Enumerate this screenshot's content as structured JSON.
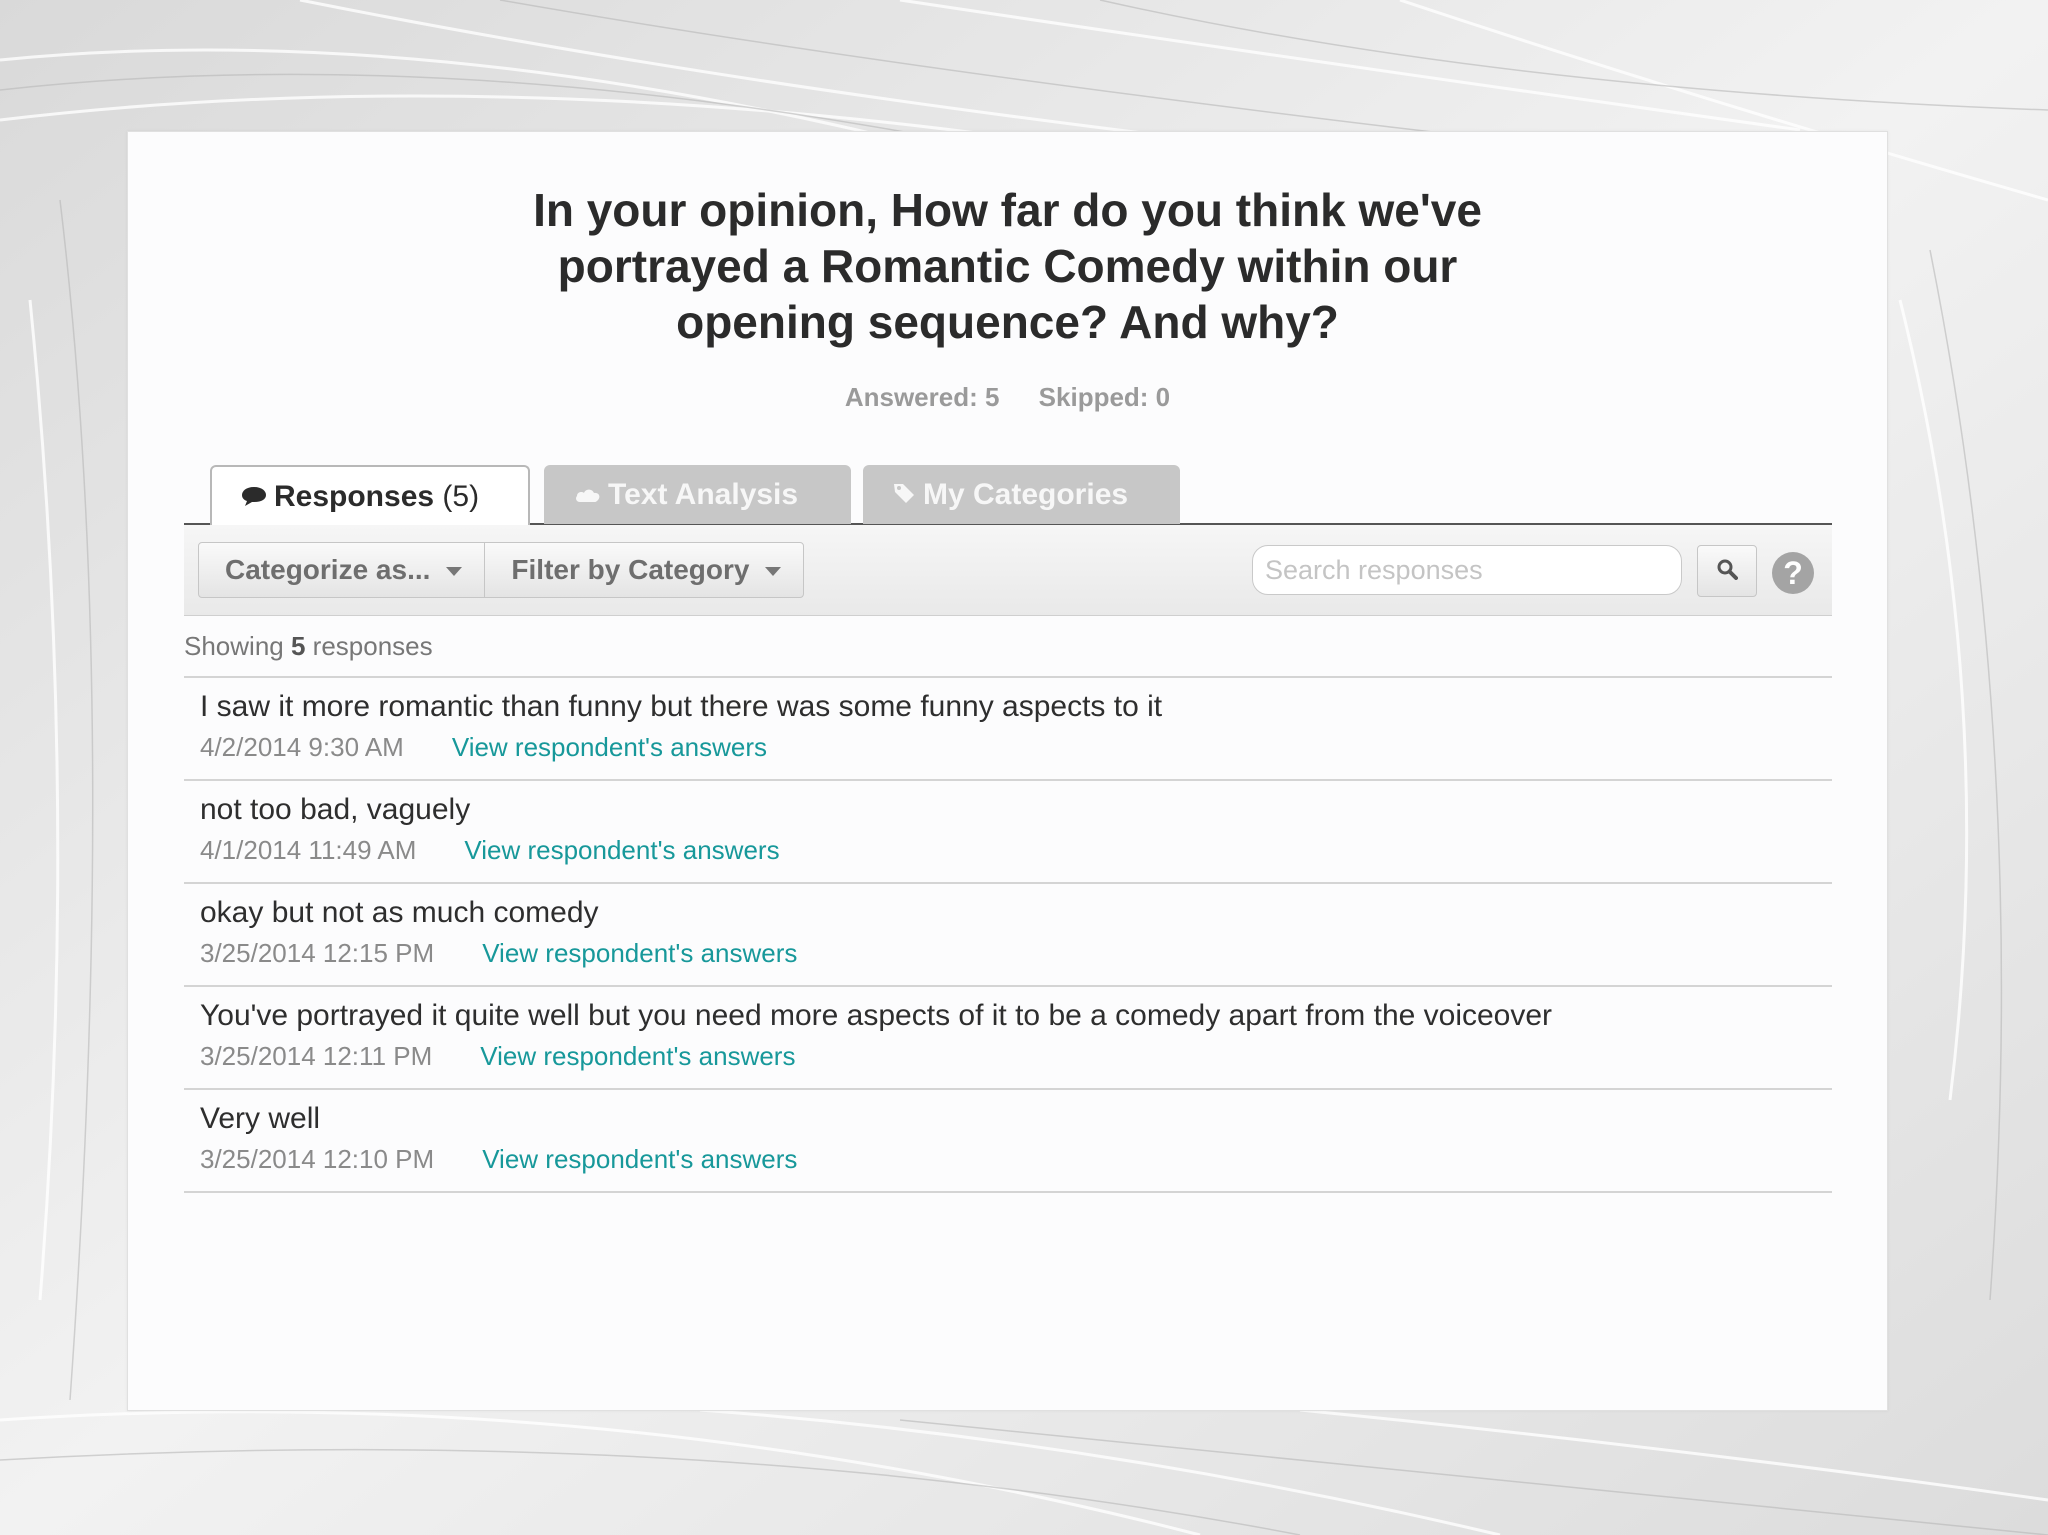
{
  "question": {
    "title": "In your opinion, How far do you think we've\nportrayed a Romantic Comedy within our\nopening sequence? And why?",
    "answered": "Answered: 5",
    "skipped": "Skipped: 0"
  },
  "tabs": [
    {
      "label": "Responses",
      "count": "(5)",
      "icon": "speech-bubble-icon",
      "active": true
    },
    {
      "label": "Text Analysis",
      "icon": "cloud-icon",
      "active": false
    },
    {
      "label": "My Categories",
      "icon": "tag-icon",
      "active": false
    }
  ],
  "toolbar": {
    "categorize_label": "Categorize as...",
    "filter_label": "Filter by Category",
    "search_placeholder": "Search responses",
    "search_icon": "magnifier-icon",
    "help_label": "?"
  },
  "summary": {
    "prefix": "Showing ",
    "count": "5",
    "suffix": " responses"
  },
  "responses": [
    {
      "text": "I saw it more romantic than funny but there was some funny aspects to it",
      "date": "4/2/2014 9:30 AM",
      "link": "View respondent's answers"
    },
    {
      "text": "not too bad, vaguely",
      "date": "4/1/2014 11:49 AM",
      "link": "View respondent's answers"
    },
    {
      "text": "okay but not as much comedy",
      "date": "3/25/2014 12:15 PM",
      "link": "View respondent's answers"
    },
    {
      "text": "You've portrayed it quite well but you need more aspects of it to be a comedy apart from the voiceover",
      "date": "3/25/2014 12:11 PM",
      "link": "View respondent's answers"
    },
    {
      "text": "Very well",
      "date": "3/25/2014 12:10 PM",
      "link": "View respondent's answers"
    }
  ],
  "colors": {
    "link": "#17989a",
    "inactive_tab": "#c7c7c7"
  }
}
